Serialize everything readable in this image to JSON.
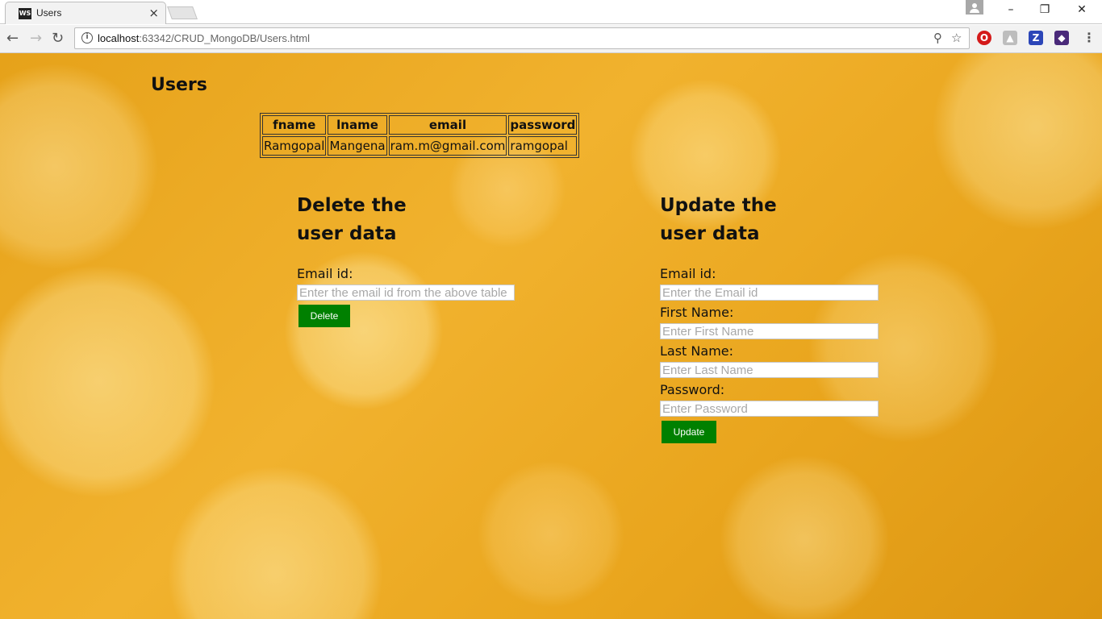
{
  "browser": {
    "tab_title": "Users",
    "tab_favicon": "WS",
    "url_host": "localhost",
    "url_rest": ":63342/CRUD_MongoDB/Users.html"
  },
  "page": {
    "title": "Users",
    "table": {
      "headers": [
        "fname",
        "lname",
        "email",
        "password"
      ],
      "rows": [
        [
          "Ramgopal",
          "Mangena",
          "ram.m@gmail.com",
          "ramgopal"
        ]
      ]
    },
    "delete": {
      "heading_line1": "Delete the",
      "heading_line2": "user data",
      "email_label": "Email id:",
      "email_placeholder": "Enter the email id from the above table",
      "button": "Delete"
    },
    "update": {
      "heading_line1": "Update the",
      "heading_line2": "user data",
      "email_label": "Email id:",
      "email_placeholder": "Enter the Email id",
      "fname_label": "First Name:",
      "fname_placeholder": "Enter First Name",
      "lname_label": "Last Name:",
      "lname_placeholder": "Enter Last Name",
      "password_label": "Password:",
      "password_placeholder": "Enter Password",
      "button": "Update"
    }
  },
  "colors": {
    "button": "#008000",
    "background": "#e9a51d"
  },
  "icons": [
    "info-icon",
    "zoom-icon",
    "star-icon",
    "opera-icon",
    "drive-icon",
    "zotero-icon",
    "extension-icon",
    "menu-icon"
  ]
}
